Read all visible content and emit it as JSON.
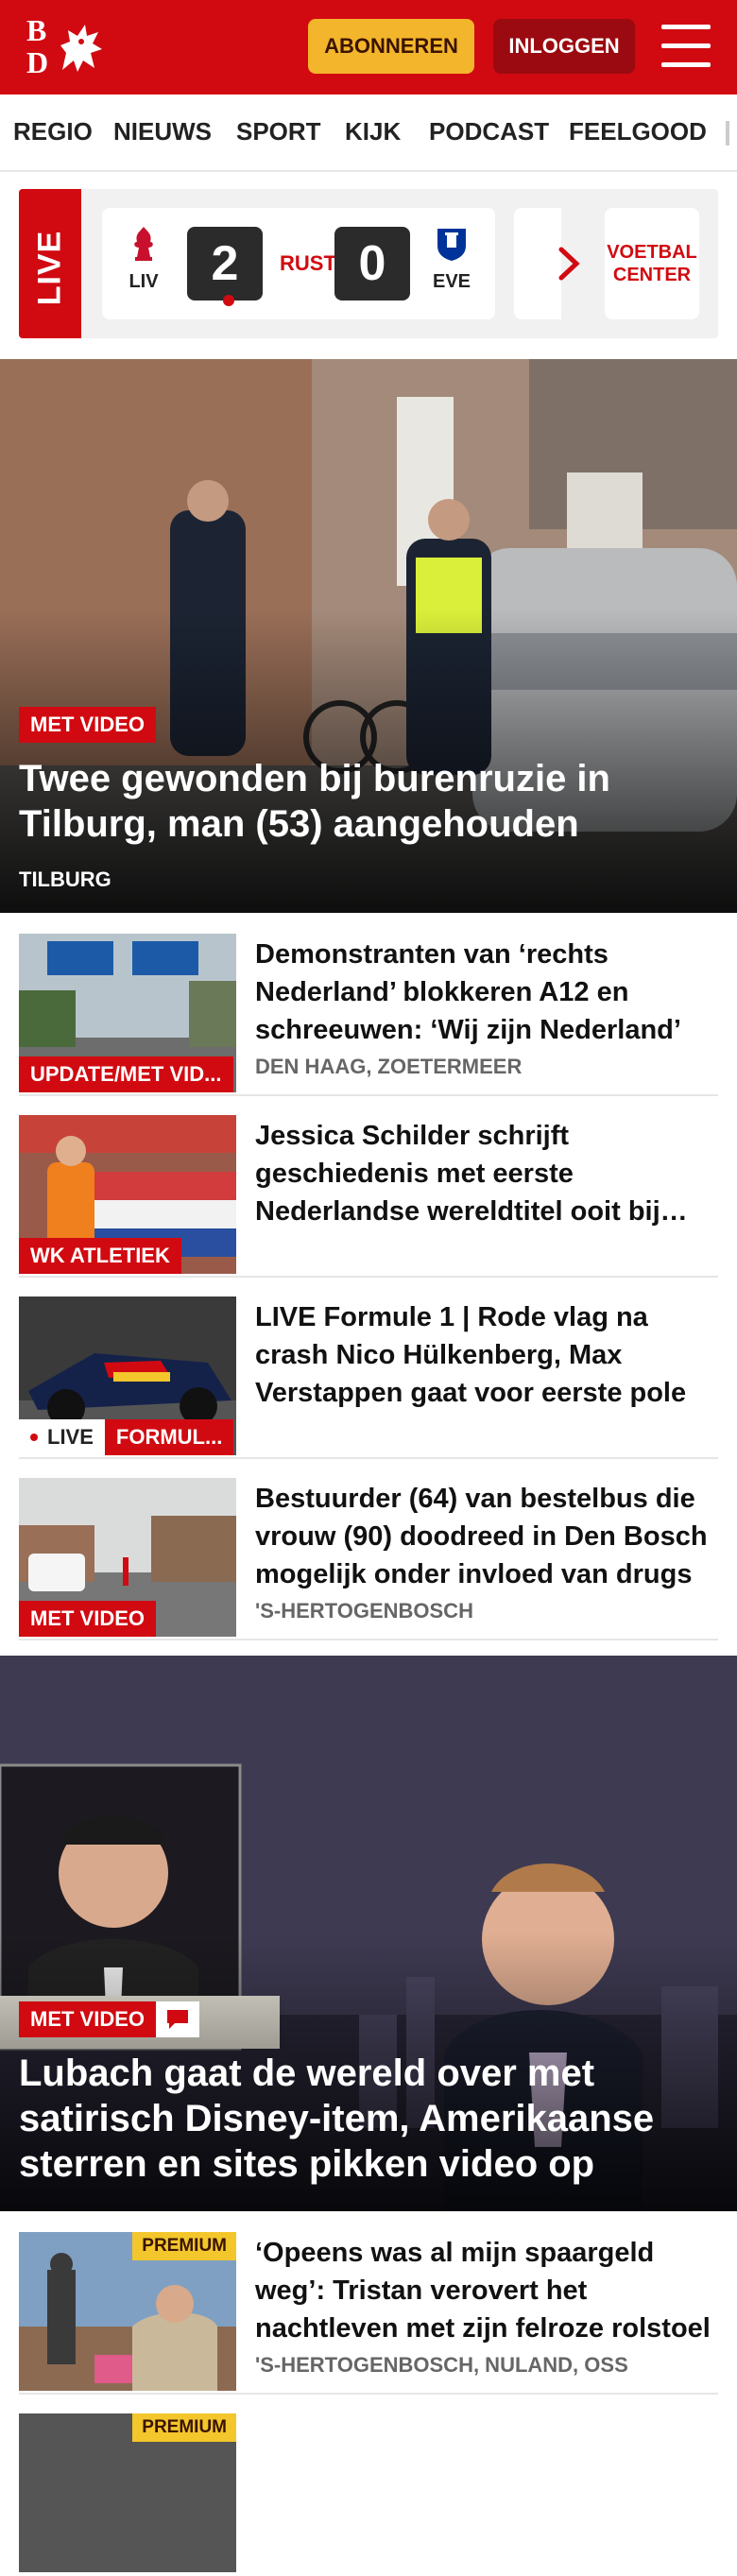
{
  "header": {
    "subscribe_label": "ABONNEREN",
    "login_label": "INLOGGEN",
    "logo_text_b": "B",
    "logo_text_d": "D",
    "colors": {
      "brand_red": "#d10a11",
      "subscribe_yellow": "#f3b52b",
      "login_dark_red": "#9a0a10"
    }
  },
  "nav": {
    "items": [
      "REGIO",
      "NIEUWS",
      "SPORT",
      "KIJK",
      "PODCAST",
      "FEELGOOD"
    ]
  },
  "live": {
    "badge": "LIVE",
    "match": {
      "home_abbr": "LIV",
      "home_score": "2",
      "status": "RUST",
      "away_score": "0",
      "away_abbr": "EVE"
    },
    "cta_label": "VOETBAL CENTER"
  },
  "hero": {
    "tag": "MET VIDEO",
    "title": "Twee gewonden bij burenruzie in Tilburg, man (53) aangehouden",
    "location": "TILBURG"
  },
  "articles": [
    {
      "tag": "UPDATE/MET VID...",
      "title": "Demonstranten van ‘rechts Nederland’ blokkeren A12 en schreeuwen: ‘Wij zijn Nederland’",
      "location": "DEN HAAG, ZOETERMEER"
    },
    {
      "tag": "WK ATLETIEK",
      "title": "Jessica Schilder schrijft geschiedenis met eerste Nederlandse wereldtitel ooit bij kogelstoten",
      "location": ""
    },
    {
      "tag": "FORMUL...",
      "live_label": "LIVE",
      "title": "LIVE Formule 1 | Rode vlag na crash Nico Hülkenberg, Max Verstappen gaat voor eerste pole",
      "location": ""
    },
    {
      "tag": "MET VIDEO",
      "title": "Bestuurder (64) van bestelbus die vrouw (90) doodreed in Den Bosch mogelijk onder invloed van drugs",
      "location": "'S-HERTOGENBOSCH"
    }
  ],
  "video_hero": {
    "tag": "MET VIDEO",
    "title": "Lubach gaat de wereld over met satirisch Disney-item, Amerikaanse sterren en sites pikken video op"
  },
  "premium_articles": [
    {
      "badge": "PREMIUM",
      "title": "‘Opeens was al mijn spaargeld weg’: Tristan verovert het nachtleven met zijn felroze rolstoel",
      "location": "'S-HERTOGENBOSCH, NULAND, OSS"
    },
    {
      "badge": "PREMIUM",
      "title": "",
      "location": ""
    }
  ]
}
